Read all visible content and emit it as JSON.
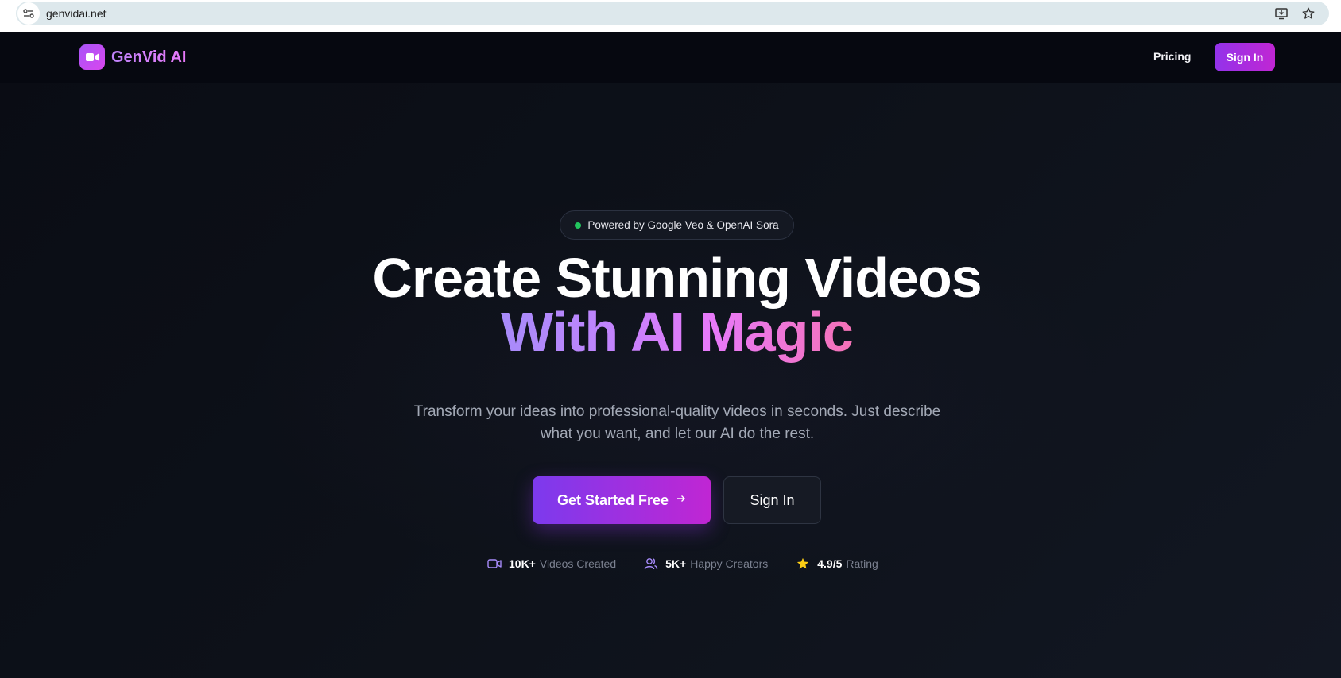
{
  "browser": {
    "url": "genvidai.net"
  },
  "nav": {
    "brand": "GenVid AI",
    "pricing": "Pricing",
    "sign_in": "Sign In"
  },
  "hero": {
    "badge": "Powered by Google Veo & OpenAI Sora",
    "headline_line1": "Create Stunning Videos",
    "headline_line2": "With AI Magic",
    "subtitle": "Transform your ideas into professional-quality videos in seconds. Just describe what you want, and let our AI do the rest.",
    "cta_primary": "Get Started Free",
    "cta_primary_icon": "arrow-right-icon",
    "cta_secondary": "Sign In"
  },
  "stats": [
    {
      "icon": "video-camera-icon",
      "value": "10K+",
      "label": "Videos Created"
    },
    {
      "icon": "users-icon",
      "value": "5K+",
      "label": "Happy Creators"
    },
    {
      "icon": "star-icon",
      "value": "4.9/5",
      "label": "Rating"
    }
  ],
  "colors": {
    "accent_start": "#7c3aed",
    "accent_end": "#c026d3",
    "status_green": "#22c55e",
    "star_yellow": "#facc15",
    "background": "#0b0e16"
  }
}
